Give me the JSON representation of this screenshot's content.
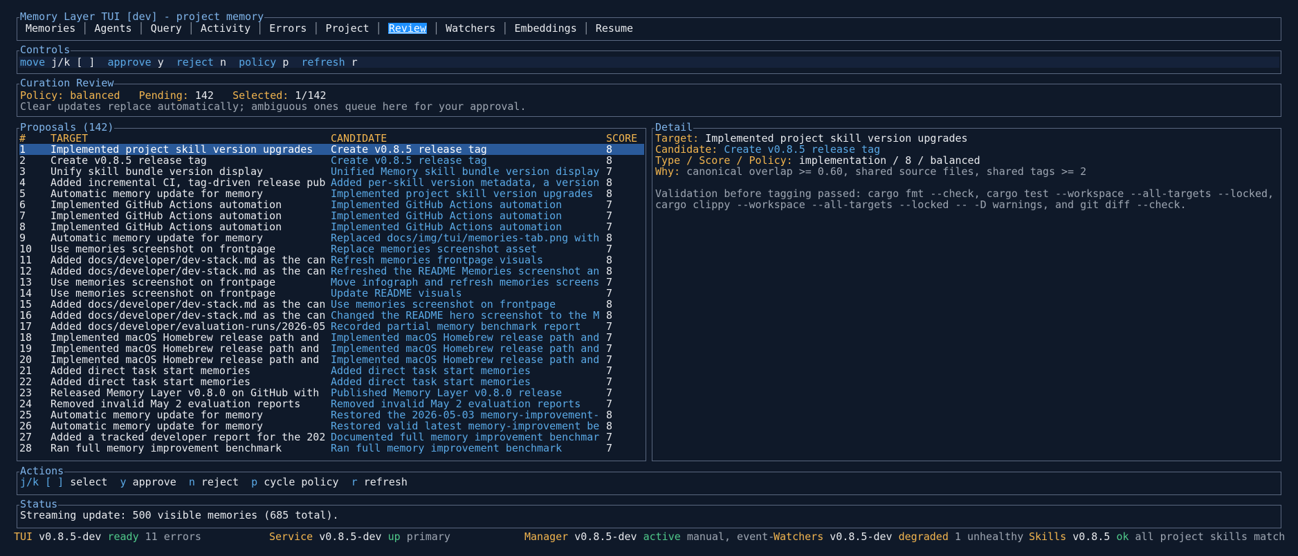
{
  "header": {
    "title": "Memory Layer TUI [dev] - project memory",
    "tabs": [
      "Memories",
      "Agents",
      "Query",
      "Activity",
      "Errors",
      "Project",
      "Review",
      "Watchers",
      "Embeddings",
      "Resume"
    ],
    "active_tab": "Review",
    "separator": "│"
  },
  "controls": {
    "title": "Controls",
    "items": [
      {
        "label": "move",
        "key": "j/k [ ]"
      },
      {
        "label": "approve",
        "key": "y"
      },
      {
        "label": "reject",
        "key": "n"
      },
      {
        "label": "policy",
        "key": "p"
      },
      {
        "label": "refresh",
        "key": "r"
      }
    ]
  },
  "review": {
    "title": "Curation Review",
    "policy_label": "Policy:",
    "policy_value": "balanced",
    "pending_label": "Pending:",
    "pending_value": "142",
    "selected_label": "Selected:",
    "selected_value": "1/142",
    "note": "Clear updates replace automatically; ambiguous ones queue here for your approval."
  },
  "proposals": {
    "title": "Proposals (142)",
    "columns": [
      "#",
      "TARGET",
      "CANDIDATE",
      "SCORE"
    ],
    "selected_index": 0,
    "rows": [
      [
        "1",
        "Implemented project skill version upgrades",
        "Create v0.8.5 release tag",
        "8"
      ],
      [
        "2",
        "Create v0.8.5 release tag",
        "Create v0.8.5 release tag",
        "8"
      ],
      [
        "3",
        "Unify skill bundle version display",
        "Unified Memory skill bundle version display",
        "7"
      ],
      [
        "4",
        "Added incremental CI, tag-driven release pub",
        "Added per-skill version metadata, a version",
        "8"
      ],
      [
        "5",
        "Automatic memory update for memory",
        "Implemented project skill version upgrades",
        "8"
      ],
      [
        "6",
        "Implemented GitHub Actions automation",
        "Implemented GitHub Actions automation",
        "7"
      ],
      [
        "7",
        "Implemented GitHub Actions automation",
        "Implemented GitHub Actions automation",
        "7"
      ],
      [
        "8",
        "Implemented GitHub Actions automation",
        "Implemented GitHub Actions automation",
        "7"
      ],
      [
        "9",
        "Automatic memory update for memory",
        "Replaced docs/img/tui/memories-tab.png with",
        "8"
      ],
      [
        "10",
        "Use memories screenshot on frontpage",
        "Replace memories screenshot asset",
        "7"
      ],
      [
        "11",
        "Added docs/developer/dev-stack.md as the can",
        "Refresh memories frontpage visuals",
        "8"
      ],
      [
        "12",
        "Added docs/developer/dev-stack.md as the can",
        "Refreshed the README Memories screenshot an",
        "8"
      ],
      [
        "13",
        "Use memories screenshot on frontpage",
        "Move infograph and refresh memories screens",
        "7"
      ],
      [
        "14",
        "Use memories screenshot on frontpage",
        "Update README visuals",
        "7"
      ],
      [
        "15",
        "Added docs/developer/dev-stack.md as the can",
        "Use memories screenshot on frontpage",
        "8"
      ],
      [
        "16",
        "Added docs/developer/dev-stack.md as the can",
        "Changed the README hero screenshot to the M",
        "8"
      ],
      [
        "17",
        "Added docs/developer/evaluation-runs/2026-05",
        "Recorded partial memory benchmark report",
        "7"
      ],
      [
        "18",
        "Implemented macOS Homebrew release path and",
        "Implemented macOS Homebrew release path and",
        "7"
      ],
      [
        "19",
        "Implemented macOS Homebrew release path and",
        "Implemented macOS Homebrew release path and",
        "7"
      ],
      [
        "20",
        "Implemented macOS Homebrew release path and",
        "Implemented macOS Homebrew release path and",
        "7"
      ],
      [
        "21",
        "Added direct task start memories",
        "Added direct task start memories",
        "7"
      ],
      [
        "22",
        "Added direct task start memories",
        "Added direct task start memories",
        "7"
      ],
      [
        "23",
        "Released Memory Layer v0.8.0 on GitHub with",
        "Published Memory Layer v0.8.0 release",
        "7"
      ],
      [
        "24",
        "Removed invalid May 2 evaluation reports",
        "Removed invalid May 2 evaluation reports",
        "7"
      ],
      [
        "25",
        "Automatic memory update for memory",
        "Restored the 2026-05-03 memory-improvement-",
        "8"
      ],
      [
        "26",
        "Automatic memory update for memory",
        "Restored valid latest memory-improvement be",
        "8"
      ],
      [
        "27",
        "Added a tracked developer report for the 202",
        "Documented full memory improvement benchmar",
        "7"
      ],
      [
        "28",
        "Ran full memory improvement benchmark",
        "Ran full memory improvement benchmark",
        "7"
      ]
    ]
  },
  "detail": {
    "title": "Detail",
    "target_label": "Target:",
    "target_value": "Implemented project skill version upgrades",
    "candidate_label": "Candidate:",
    "candidate_value": "Create v0.8.5 release tag",
    "tsp_label": "Type / Score / Policy:",
    "tsp_value": "implementation / 8 / balanced",
    "why_label": "Why:",
    "why_value": "canonical overlap >= 0.60, shared source files, shared tags >= 2",
    "body_line1": "Validation before tagging passed: cargo fmt --check, cargo test --workspace --all-targets --locked,",
    "body_line2": "cargo clippy --workspace --all-targets --locked -- -D warnings, and git diff --check."
  },
  "actions": {
    "title": "Actions",
    "items": [
      {
        "key": "j/k [ ]",
        "label": "select"
      },
      {
        "key": "y",
        "label": "approve"
      },
      {
        "key": "n",
        "label": "reject"
      },
      {
        "key": "p",
        "label": "cycle policy"
      },
      {
        "key": "r",
        "label": "refresh"
      }
    ]
  },
  "status": {
    "title": "Status",
    "text": "Streaming update: 500 visible memories (685 total)."
  },
  "statusbar": {
    "tui": {
      "name": "TUI",
      "version": "v0.8.5-dev",
      "state": "ready",
      "info": "11 errors"
    },
    "service": {
      "name": "Service",
      "version": "v0.8.5-dev",
      "state": "up",
      "info": "primary"
    },
    "manager": {
      "name": "Manager",
      "version": "v0.8.5-dev",
      "state": "active",
      "info": "manual, event-"
    },
    "watchers": {
      "name": "Watchers",
      "version": "v0.8.5-dev",
      "state": "degraded",
      "info": "1 unhealthy"
    },
    "skills": {
      "name": "Skills",
      "version": "v0.8.5",
      "state": "ok",
      "info": "all project skills match"
    }
  },
  "colors": {
    "background": "#0f1929",
    "accent_blue": "#5aa9e6",
    "label_orange": "#f2b54f",
    "selection": "#2a5a9a",
    "active_tab": "#1e90ff",
    "ok_green": "#4fc98a"
  }
}
